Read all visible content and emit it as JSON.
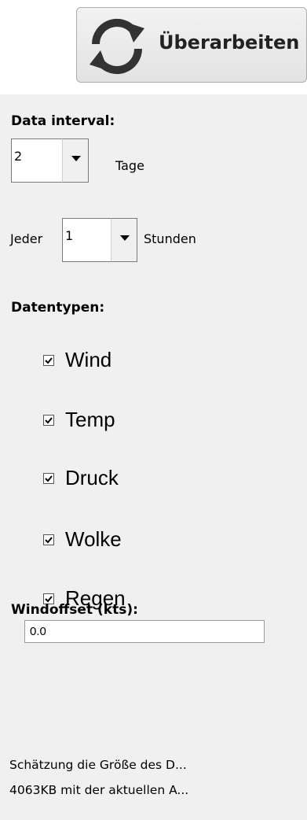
{
  "refresh_button": {
    "label": "Überarbeiten",
    "icon": "refresh-icon"
  },
  "data_interval": {
    "heading": "Data interval:",
    "days_value": "2",
    "days_unit": "Tage",
    "every_prefix": "Jeder",
    "hours_value": "1",
    "hours_unit": "Stunden"
  },
  "data_types": {
    "heading": "Datentypen:",
    "items": [
      {
        "label": "Wind",
        "checked": true
      },
      {
        "label": "Temp",
        "checked": true
      },
      {
        "label": "Druck",
        "checked": true
      },
      {
        "label": "Wolke",
        "checked": true
      },
      {
        "label": "Regen",
        "checked": true
      }
    ]
  },
  "wind_offset": {
    "heading": "Windoffset (kts):",
    "value": "0.0"
  },
  "estimate": {
    "line1": "Schätzung die Größe des D...",
    "line2": "4063KB mit der aktuellen A..."
  }
}
